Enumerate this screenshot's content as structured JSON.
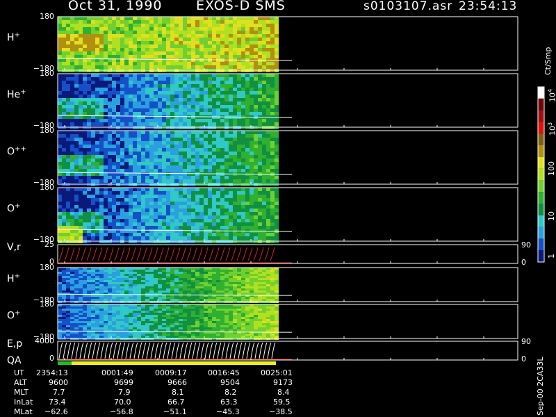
{
  "header": {
    "date": "Oct 31, 1990",
    "instrument": "EXOS-D SMS",
    "file": "s0103107.asr",
    "time": "23:54:13"
  },
  "panels": [
    {
      "label": "H",
      "sup": "+",
      "top": "180",
      "bottom": "−180"
    },
    {
      "label": "He",
      "sup": "+",
      "top": "180",
      "bottom": "−180"
    },
    {
      "label": "O",
      "sup": "++",
      "top": "180",
      "bottom": "−180"
    },
    {
      "label": "O",
      "sup": "+",
      "top": "180",
      "bottom": "−180"
    },
    {
      "label": "V,r",
      "sup": "",
      "top": "25",
      "bottom": "0",
      "rtop": "90",
      "rbottom": "0"
    },
    {
      "label": "H",
      "sup": "+",
      "top": "180",
      "bottom": "−180"
    },
    {
      "label": "O",
      "sup": "+",
      "top": "180",
      "bottom": "−180"
    },
    {
      "label": "E,p",
      "sup": "",
      "top": "4000",
      "bottom": "0",
      "rtop": "90",
      "rbottom": "0"
    }
  ],
  "qa_label": "QA",
  "colorbar": {
    "unit": "Ct/Smp",
    "tick_labels": [
      "1",
      "10",
      "100",
      "10",
      "10"
    ],
    "exponents": [
      "",
      "",
      "",
      "3",
      "4"
    ]
  },
  "side_note": "Sep-00 2CA33L",
  "footer": {
    "rows": [
      {
        "name": "UT",
        "values": [
          "2354:13",
          "0001:49",
          "0009:17",
          "0016:45",
          "0025:01"
        ]
      },
      {
        "name": "ALT",
        "values": [
          "9600",
          "9699",
          "9666",
          "9504",
          "9173"
        ]
      },
      {
        "name": "MLT",
        "values": [
          "7.7",
          "7.9",
          "8.1",
          "8.2",
          "8.4"
        ]
      },
      {
        "name": "InLat",
        "values": [
          "73.4",
          "70.0",
          "66.7",
          "63.3",
          "59.5"
        ]
      },
      {
        "name": "MLat",
        "values": [
          "−62.6",
          "−56.8",
          "−51.1",
          "−45.3",
          "−38.5"
        ]
      }
    ]
  },
  "chart_data": {
    "type": "heatmap",
    "title": "Oct 31, 1990   EXOS-D SMS",
    "x": [
      "2354:13",
      "0001:49",
      "0009:17",
      "0016:45",
      "0025:01"
    ],
    "ylim": [
      -180,
      180
    ],
    "colorscale": [
      "#0a1a7a",
      "#1550c8",
      "#2aa0e0",
      "#30c8c8",
      "#109040",
      "#30b030",
      "#70d030",
      "#b0e020",
      "#e0e020",
      "#b09010",
      "#806010",
      "#e01010",
      "#a01010",
      "#700808",
      "#ffffff"
    ],
    "colorbar_range": [
      1,
      10000
    ],
    "colorbar_scale": "log"
  }
}
